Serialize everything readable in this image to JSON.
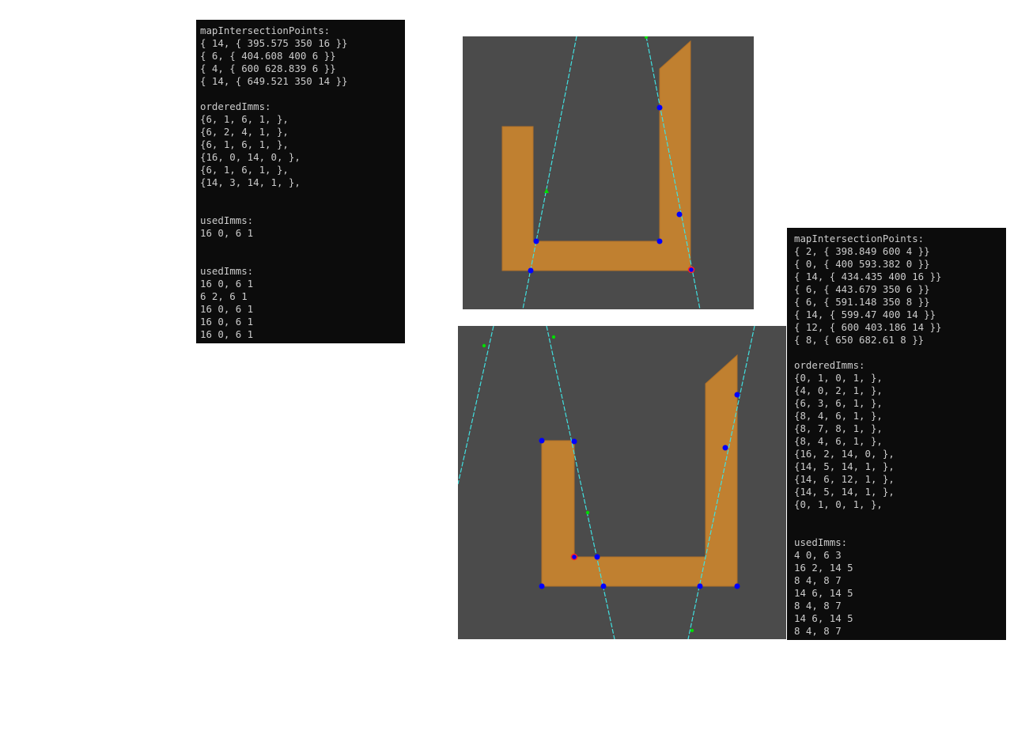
{
  "left_console": {
    "lines": [
      "mapIntersectionPoints:",
      "{ 14, { 395.575 350 16 }}",
      "{ 6, { 404.608 400 6 }}",
      "{ 4, { 600 628.839 6 }}",
      "{ 14, { 649.521 350 14 }}",
      "",
      "orderedImms:",
      "{6, 1, 6, 1, },",
      "{6, 2, 4, 1, },",
      "{6, 1, 6, 1, },",
      "{16, 0, 14, 0, },",
      "{6, 1, 6, 1, },",
      "{14, 3, 14, 1, },",
      "",
      "",
      "usedImms:",
      "16 0, 6 1",
      "",
      "",
      "usedImms:",
      "16 0, 6 1",
      "6 2, 6 1",
      "16 0, 6 1",
      "16 0, 6 1",
      "16 0, 6 1"
    ]
  },
  "right_console": {
    "lines": [
      "mapIntersectionPoints:",
      "{ 2, { 398.849 600 4 }}",
      "{ 0, { 400 593.382 0 }}",
      "{ 14, { 434.435 400 16 }}",
      "{ 6, { 443.679 350 6 }}",
      "{ 6, { 591.148 350 8 }}",
      "{ 14, { 599.47 400 14 }}",
      "{ 12, { 600 403.186 14 }}",
      "{ 8, { 650 682.61 8 }}",
      "",
      "orderedImms:",
      "{0, 1, 0, 1, },",
      "{4, 0, 2, 1, },",
      "{6, 3, 6, 1, },",
      "{8, 4, 6, 1, },",
      "{8, 7, 8, 1, },",
      "{8, 4, 6, 1, },",
      "{16, 2, 14, 0, },",
      "{14, 5, 14, 1, },",
      "{14, 6, 12, 1, },",
      "{14, 5, 14, 1, },",
      "{0, 1, 0, 1, },",
      "",
      "",
      "usedImms:",
      "4 0, 6 3",
      "16 2, 14 5",
      "8 4, 8 7",
      "14 6, 14 5",
      "8 4, 8 7",
      "14 6, 14 5",
      "8 4, 8 7"
    ]
  },
  "colors": {
    "console_bg": "#0c0c0c",
    "console_text": "#cccccc",
    "viewport_bg": "#4b4b4b",
    "shape_fill": "#c08030",
    "cut_line": "#40e0e0",
    "intersection_point": "#0000ff",
    "marker_point": "#00dd00",
    "highlight_point": "#ff2020"
  }
}
